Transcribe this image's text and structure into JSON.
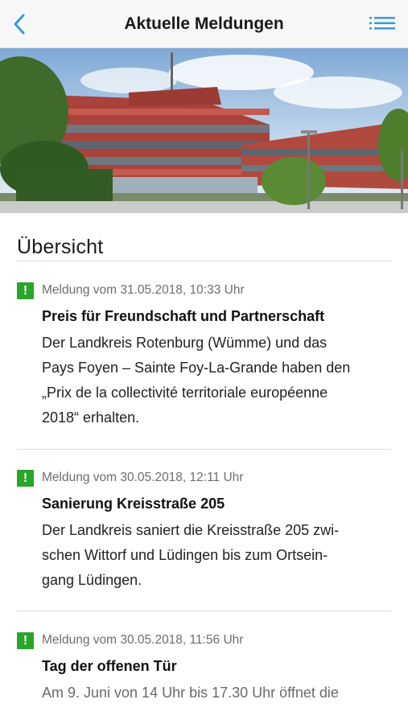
{
  "header": {
    "title": "Aktuelle Meldungen",
    "back_icon": "chevron-left-icon",
    "menu_icon": "list-menu-icon",
    "accent_color": "#3a9ad9"
  },
  "overview": {
    "title": "Übersicht"
  },
  "news": [
    {
      "meta": "Meldung vom 31.05.2018, 10:33 Uhr",
      "title": "Preis für Freundschaft und Partnerschaft",
      "body_lines": [
        "Der Landkreis Rotenburg (Wümme) und das",
        "Pays Foyen – Sainte Foy-La-Grande haben den",
        "„Prix de la collectivité territoriale européenne",
        "2018“ erhalten."
      ]
    },
    {
      "meta": "Meldung vom 30.05.2018, 12:11 Uhr",
      "title": "Sanierung Kreisstraße 205",
      "body_lines": [
        "Der Landkreis saniert die Kreisstraße 205 zwi-",
        "schen Wittorf und Lüdingen bis zum Ortsein-",
        "gang Lüdingen."
      ]
    },
    {
      "meta": "Meldung vom 30.05.2018, 11:56 Uhr",
      "title": "Tag der offenen Tür",
      "body_lines": [
        "Am 9. Juni von 14 Uhr bis 17.30 Uhr öffnet die"
      ]
    }
  ],
  "badge": {
    "symbol": "!",
    "color": "#2aa52a"
  }
}
